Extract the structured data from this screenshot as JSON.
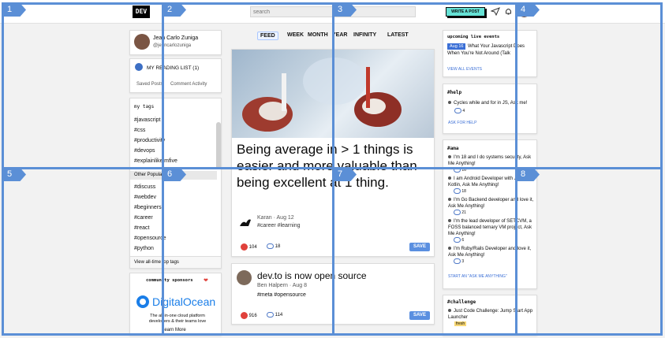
{
  "topbar": {
    "logo": "DEV",
    "search_placeholder": "search",
    "write_post": "WRITE A POST"
  },
  "profile": {
    "name": "Jean Carlo Zuniga",
    "handle": "@jeancarlozuniga"
  },
  "reading": {
    "title": "MY READING LIST (1)",
    "saved": "Saved Posts",
    "comment": "Comment Activity"
  },
  "tags": {
    "heading": "my tags",
    "items": [
      "#javascript",
      "#css",
      "#productivity",
      "#devops",
      "#explainlikeimfive"
    ],
    "other_heading": "Other Popular",
    "other_items": [
      "#discuss",
      "#webdev",
      "#beginners",
      "#career",
      "#react",
      "#opensource",
      "#python"
    ],
    "footer": "View all-time top tags"
  },
  "sponsors": {
    "heading": "community sponsors",
    "brand": "DigitalOcean",
    "blurb": "The all-in-one cloud platform developers & their teams love",
    "more": "Learn More"
  },
  "feed_tabs": [
    "FEED",
    "WEEK",
    "MONTH",
    "YEAR",
    "INFINITY",
    "LATEST"
  ],
  "posts": [
    {
      "title": "Being average in > 1 things is easier and more valuable than being excellent at 1 thing.",
      "author": "Karan · Aug 12",
      "tags": "#career #learning",
      "reactions": "104",
      "comments": "18",
      "save": "SAVE"
    },
    {
      "title": "dev.to is now open source",
      "author": "Ben Halpern · Aug 8",
      "tags": "#meta #opensource",
      "reactions": "916",
      "comments": "114",
      "save": "SAVE"
    }
  ],
  "upcoming": {
    "heading": "upcoming live events",
    "badge": "Aug 16",
    "title": "What Your Javascript Does When You're Not Around (Talk",
    "link": "VIEW ALL EVENTS"
  },
  "help": {
    "heading": "#help",
    "item": "Cycles while and for in JS, Ask me!",
    "count": "4",
    "link": "ASK FOR HELP"
  },
  "ama": {
    "heading": "#ama",
    "items": [
      {
        "text": "I'm 18 and I do systems security, Ask Me Anything!",
        "count": "16"
      },
      {
        "text": "I am Android Developer with Java and Kotlin, Ask Me Anything!",
        "count": "18"
      },
      {
        "text": "I'm Go Backend developer and love it, Ask Me Anything!",
        "count": "21"
      },
      {
        "text": "I'm the lead developer of SETCVM, a FOSS balanced ternary VM project, Ask Me Anything!",
        "count": "6"
      },
      {
        "text": "I'm Ruby/Rails Developer and love it, Ask Me Anything!",
        "count": "3"
      }
    ],
    "link": "START AN \"ASK ME ANYTHING\""
  },
  "challenge": {
    "heading": "#challenge",
    "item": "Just Code Challenge: Jump Start App Launcher",
    "badge": "fresh"
  },
  "grid_labels": [
    "1",
    "2",
    "3",
    "4",
    "5",
    "6",
    "7",
    "8"
  ]
}
